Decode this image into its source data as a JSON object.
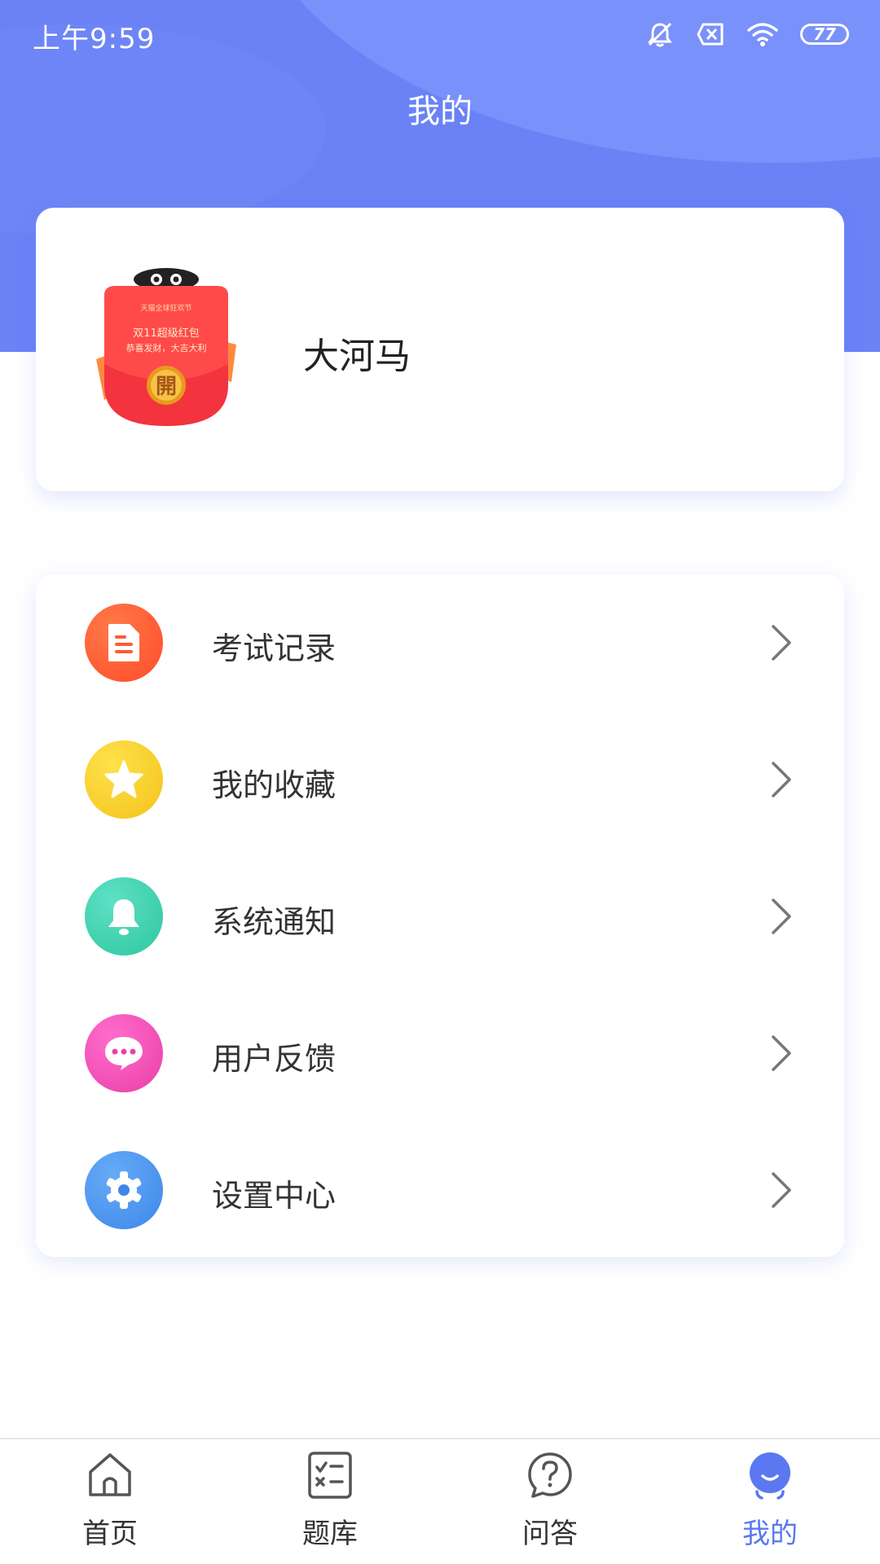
{
  "status_bar": {
    "time": "上午9:59",
    "battery": "77"
  },
  "header": {
    "title": "我的"
  },
  "profile": {
    "username": "大河马",
    "avatar": {
      "line1": "双11超级红包",
      "line2": "恭喜发财，大吉大利",
      "button": "開"
    }
  },
  "menu": {
    "items": [
      {
        "label": "考试记录",
        "icon": "document-icon",
        "color": "#ff5a36"
      },
      {
        "label": "我的收藏",
        "icon": "star-icon",
        "color": "#f8d02a"
      },
      {
        "label": "系统通知",
        "icon": "bell-icon",
        "color": "#3fcfb0"
      },
      {
        "label": "用户反馈",
        "icon": "chat-icon",
        "color": "#f04fb0"
      },
      {
        "label": "设置中心",
        "icon": "gear-icon",
        "color": "#4f95f0"
      }
    ]
  },
  "nav": {
    "items": [
      {
        "label": "首页",
        "icon": "home-icon"
      },
      {
        "label": "题库",
        "icon": "question-bank-icon"
      },
      {
        "label": "问答",
        "icon": "question-icon"
      },
      {
        "label": "我的",
        "icon": "profile-icon",
        "active": true
      }
    ],
    "active_color": "#5b78f2"
  }
}
